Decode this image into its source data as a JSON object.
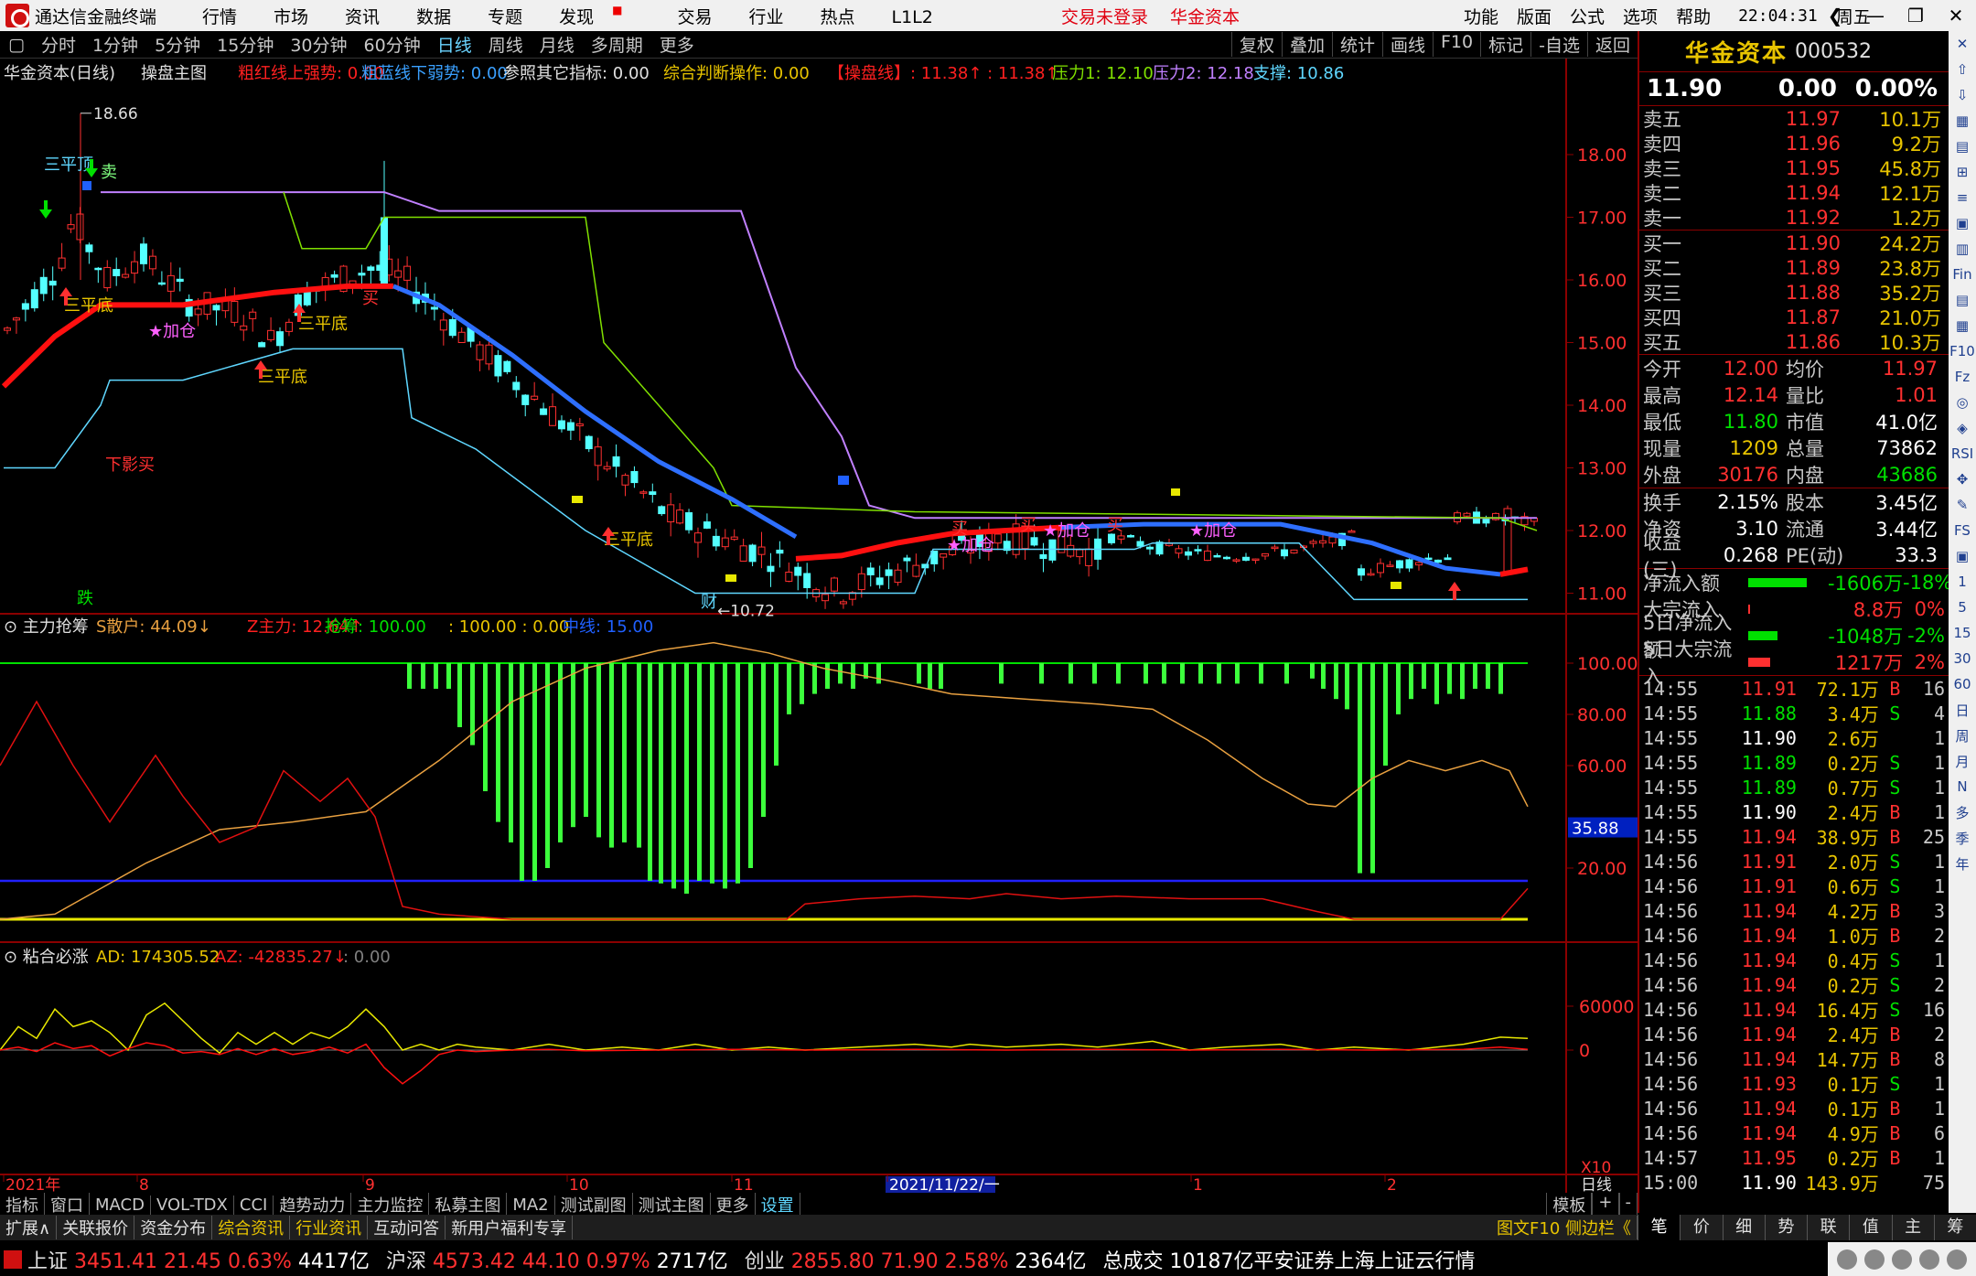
{
  "app": {
    "name": "通达信金融终端",
    "menu": [
      "行情",
      "市场",
      "资讯",
      "数据",
      "专题",
      "发现",
      "交易",
      "行业",
      "热点",
      "L1L2"
    ],
    "center": [
      "交易未登录",
      "华金资本"
    ],
    "right_menu": [
      "功能",
      "版面",
      "公式",
      "选项",
      "帮助"
    ],
    "clock": "22:04:31",
    "weekday": "周五"
  },
  "toolbar": {
    "periods": [
      "分时",
      "1分钟",
      "5分钟",
      "15分钟",
      "30分钟",
      "60分钟",
      "日线",
      "周线",
      "月线",
      "多周期",
      "更多"
    ],
    "active": "日线",
    "right": [
      "复权",
      "叠加",
      "统计",
      "画线",
      "F10",
      "标记",
      "-自选",
      "返回"
    ]
  },
  "main_info": {
    "stock_label": "华金资本(日线)",
    "template": "操盘主图",
    "items": [
      {
        "label": "粗红线上强势: 0.00",
        "color": "#ff2020"
      },
      {
        "label": "粗蓝线下弱势: 0.00",
        "color": "#3aa0ff"
      },
      {
        "label": "参照其它指标: 0.00",
        "color": "#e0e0e0"
      },
      {
        "label": "综合判断操作: 0.00",
        "color": "#e8c400"
      },
      {
        "label": "【操盘线】: 11.38↑ : 11.38↑",
        "color": "#ff2020"
      },
      {
        "label": "压力1: 12.10",
        "color": "#80e000"
      },
      {
        "label": "压力2: 12.18",
        "color": "#c080ff"
      },
      {
        "label": "支撑: 10.86",
        "color": "#5fd7ff"
      }
    ]
  },
  "price_axis": [
    "18.00",
    "17.00",
    "16.00",
    "15.00",
    "14.00",
    "13.00",
    "12.00",
    "11.00"
  ],
  "high_label": "18.66",
  "low_label": "←10.72",
  "annotations": {
    "sanpingding": "三平顶",
    "maichu": "卖",
    "sanpingdi": "三平底",
    "jiacang": "★加仓",
    "xiayingmai": "下影买",
    "mai": "买",
    "die": "跌",
    "cai": "财"
  },
  "panel2": {
    "title": "主力抢筹",
    "items": [
      {
        "label": "S散户: 44.09↓",
        "color": "#e8a040"
      },
      {
        "label": "Z主力: 12.64↑",
        "color": "#ff2020"
      },
      {
        "label": "抢筹: 100.00",
        "color": "#00e000"
      },
      {
        "label": ": 100.00 : 0.00",
        "color": "#e8c400"
      },
      {
        "label": "中线: 15.00",
        "color": "#2060ff"
      }
    ],
    "axis": [
      "100.00",
      "80.00",
      "60.00",
      "20.00"
    ],
    "current": "35.88"
  },
  "panel3": {
    "title": "粘合必涨",
    "items": [
      {
        "label": "AD: 174305.52",
        "color": "#e8c400"
      },
      {
        "label": "AZ: -42835.27↓",
        "color": "#ff2020"
      },
      {
        "label": ": 0.00",
        "color": "#808080"
      }
    ],
    "axis": [
      "60000",
      "0"
    ],
    "x10": "X10"
  },
  "xaxis": {
    "labels": [
      "2021年",
      "8",
      "9",
      "10",
      "11",
      "2021/11/22/一",
      "1",
      "2"
    ],
    "period": "日线"
  },
  "quote": {
    "name": "华金资本",
    "code": "000532",
    "price": "11.90",
    "change": "0.00",
    "pct": "0.00%",
    "asks": [
      {
        "label": "卖五",
        "price": "11.97",
        "vol": "10.1万"
      },
      {
        "label": "卖四",
        "price": "11.96",
        "vol": "9.2万"
      },
      {
        "label": "卖三",
        "price": "11.95",
        "vol": "45.8万"
      },
      {
        "label": "卖二",
        "price": "11.94",
        "vol": "12.1万"
      },
      {
        "label": "卖一",
        "price": "11.92",
        "vol": "1.2万"
      }
    ],
    "bids": [
      {
        "label": "买一",
        "price": "11.90",
        "vol": "24.2万",
        "pc": "white"
      },
      {
        "label": "买二",
        "price": "11.89",
        "vol": "23.8万",
        "pc": "green"
      },
      {
        "label": "买三",
        "price": "11.88",
        "vol": "35.2万",
        "pc": "green"
      },
      {
        "label": "买四",
        "price": "11.87",
        "vol": "21.0万",
        "pc": "green"
      },
      {
        "label": "买五",
        "price": "11.86",
        "vol": "10.3万",
        "pc": "green"
      }
    ],
    "stats1": [
      [
        "今开",
        "12.00",
        "red",
        "均价",
        "11.97",
        "red"
      ],
      [
        "最高",
        "12.14",
        "red",
        "量比",
        "1.01",
        "red"
      ],
      [
        "最低",
        "11.80",
        "green",
        "市值",
        "41.0亿",
        "white"
      ],
      [
        "现量",
        "1209",
        "yellow",
        "总量",
        "73862",
        "white"
      ],
      [
        "外盘",
        "30176",
        "red",
        "内盘",
        "43686",
        "green"
      ]
    ],
    "stats2": [
      [
        "换手",
        "2.15%",
        "white",
        "股本",
        "3.45亿",
        "white"
      ],
      [
        "净资",
        "3.10",
        "white",
        "流通",
        "3.44亿",
        "white"
      ],
      [
        "收益(三)",
        "0.268",
        "white",
        "PE(动)",
        "33.3",
        "white"
      ]
    ],
    "flows": [
      {
        "label": "净流入额",
        "val": "-1606万",
        "pct": "-18%",
        "color": "green",
        "bar": 80
      },
      {
        "label": "大宗流入",
        "val": "8.8万",
        "pct": "0%",
        "color": "red",
        "bar": 2
      },
      {
        "label": "5日净流入额",
        "val": "-1048万",
        "pct": "-2%",
        "color": "green",
        "bar": 40
      },
      {
        "label": "5日大宗流入",
        "val": "1217万",
        "pct": "2%",
        "color": "red",
        "bar": 30
      }
    ],
    "ticks": [
      [
        "14:55",
        "11.91",
        "red",
        "72.1万",
        "B",
        "16"
      ],
      [
        "14:55",
        "11.88",
        "green",
        "3.4万",
        "S",
        "4"
      ],
      [
        "14:55",
        "11.90",
        "white",
        "2.6万",
        "",
        "1"
      ],
      [
        "14:55",
        "11.89",
        "green",
        "0.2万",
        "S",
        "1"
      ],
      [
        "14:55",
        "11.89",
        "green",
        "0.7万",
        "S",
        "1"
      ],
      [
        "14:55",
        "11.90",
        "white",
        "2.4万",
        "B",
        "1"
      ],
      [
        "14:55",
        "11.94",
        "red",
        "38.9万",
        "B",
        "25"
      ],
      [
        "14:56",
        "11.91",
        "red",
        "2.0万",
        "S",
        "1"
      ],
      [
        "14:56",
        "11.91",
        "red",
        "0.6万",
        "S",
        "1"
      ],
      [
        "14:56",
        "11.94",
        "red",
        "4.2万",
        "B",
        "3"
      ],
      [
        "14:56",
        "11.94",
        "red",
        "1.0万",
        "B",
        "2"
      ],
      [
        "14:56",
        "11.94",
        "red",
        "0.4万",
        "S",
        "1"
      ],
      [
        "14:56",
        "11.94",
        "red",
        "0.2万",
        "S",
        "2"
      ],
      [
        "14:56",
        "11.94",
        "red",
        "16.4万",
        "S",
        "16"
      ],
      [
        "14:56",
        "11.94",
        "red",
        "2.4万",
        "B",
        "2"
      ],
      [
        "14:56",
        "11.94",
        "red",
        "14.7万",
        "B",
        "8"
      ],
      [
        "14:56",
        "11.93",
        "red",
        "0.1万",
        "S",
        "1"
      ],
      [
        "14:56",
        "11.94",
        "red",
        "0.1万",
        "B",
        "1"
      ],
      [
        "14:56",
        "11.94",
        "red",
        "4.9万",
        "B",
        "6"
      ],
      [
        "14:57",
        "11.95",
        "red",
        "0.2万",
        "B",
        "1"
      ],
      [
        "15:00",
        "11.90",
        "white",
        "143.9万",
        "",
        "75"
      ]
    ]
  },
  "sidebar_right": [
    "1",
    "5",
    "15",
    "30",
    "60",
    "日",
    "周",
    "月",
    "N",
    "多",
    "季",
    "年"
  ],
  "bottom_tabs": [
    "指标",
    "窗口",
    "MACD",
    "VOL-TDX",
    "CCI",
    "趋势动力",
    "主力监控",
    "私募主图",
    "MA2",
    "测试副图",
    "测试主图",
    "更多",
    "设置"
  ],
  "bottom_tabs_right": [
    "模板",
    "+",
    "-"
  ],
  "tabs2": [
    "扩展∧",
    "关联报价",
    "资金分布",
    "综合资讯",
    "行业资讯",
    "互动问答",
    "新用户福利专享"
  ],
  "tabs2_right": "图文F10 侧边栏《",
  "rp_tabs": [
    "笔",
    "价",
    "细",
    "势",
    "联",
    "值",
    "主",
    "筹"
  ],
  "status": [
    {
      "name": "上证",
      "v": "3451.41",
      "c": "21.45",
      "p": "0.63%",
      "a": "4417亿"
    },
    {
      "name": "沪深",
      "v": "4573.42",
      "c": "44.10",
      "p": "0.97%",
      "a": "2717亿"
    },
    {
      "name": "创业",
      "v": "2855.80",
      "c": "71.90",
      "p": "2.58%",
      "a": "2364亿"
    }
  ],
  "status_total": "总成交 10187亿平安证券上海上证云行情",
  "colors": {
    "up": "#ff3030",
    "down": "#00e000",
    "candle_down": "#54ffff",
    "ma_blue": "#2e6fff",
    "ma_red": "#ff1010"
  }
}
